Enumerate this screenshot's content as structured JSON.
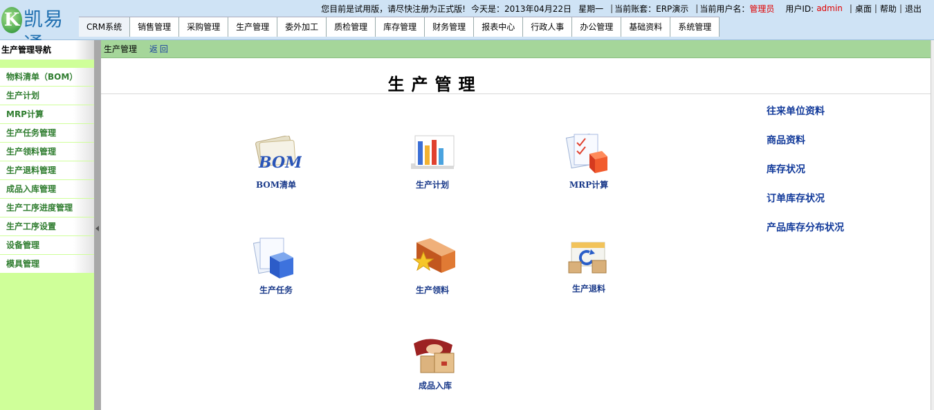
{
  "app": {
    "logo_letter": "K",
    "logo_text": "凯易通"
  },
  "infobar": {
    "trial_notice": "您目前是试用版，请尽快注册为正式版!",
    "today_label": "今天是：2013年04月22日",
    "weekday": "星期一",
    "account_label": "当前账套：ERP演示",
    "user_label": "当前用户名：",
    "user_name": "管理员",
    "userid_label": "用户ID:",
    "userid": "admin",
    "desktop": "桌面",
    "help": "帮助",
    "logout": "退出",
    "sep": "|"
  },
  "nav": [
    "CRM系统",
    "销售管理",
    "采购管理",
    "生产管理",
    "委外加工",
    "质检管理",
    "库存管理",
    "财务管理",
    "报表中心",
    "行政人事",
    "办公管理",
    "基础资料",
    "系统管理"
  ],
  "sidebar": {
    "title": "生产管理导航",
    "items": [
      "物料清单（BOM）",
      "生产计划",
      "MRP计算",
      "生产任务管理",
      "生产领料管理",
      "生产退料管理",
      "成品入库管理",
      "生产工序进度管理",
      "生产工序设置",
      "设备管理",
      "模具管理"
    ]
  },
  "crumb": {
    "current": "生产管理",
    "back": "返回"
  },
  "main": {
    "title": "生产管理",
    "tiles": {
      "bom": "BOM清单",
      "plan": "生产计划",
      "mrp": "MRP计算",
      "task": "生产任务",
      "pick": "生产领料",
      "return": "生产退料",
      "stockin": "成品入库"
    },
    "icon_bom_text": "BOM",
    "quick_links": [
      "往来单位资料",
      "商品资料",
      "库存状况",
      "订单库存状况",
      "产品库存分布状况"
    ]
  },
  "colors": {
    "topbar": "#cfe3f5",
    "sidebar": "#cfff99",
    "crumbbar": "#a5d69a",
    "accent_red": "#e00000",
    "link_blue": "#123a9a"
  }
}
